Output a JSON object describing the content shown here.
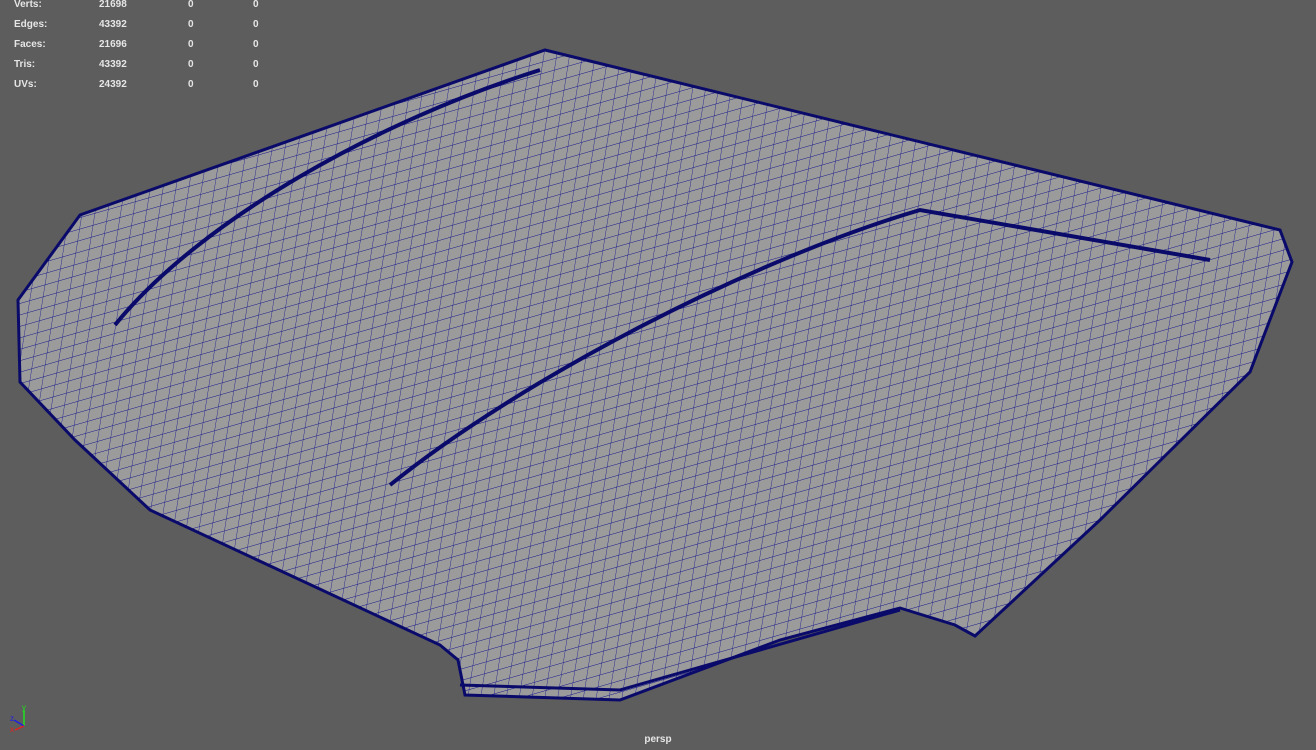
{
  "hud": {
    "rows": [
      {
        "label": "Verts:",
        "values": [
          "21698",
          "0",
          "0"
        ]
      },
      {
        "label": "Edges:",
        "values": [
          "43392",
          "0",
          "0"
        ]
      },
      {
        "label": "Faces:",
        "values": [
          "21696",
          "0",
          "0"
        ]
      },
      {
        "label": "Tris:",
        "values": [
          "43392",
          "0",
          "0"
        ]
      },
      {
        "label": "UVs:",
        "values": [
          "24392",
          "0",
          "0"
        ]
      }
    ]
  },
  "camera": {
    "name": "persp"
  },
  "axis": {
    "x": "x",
    "y": "y",
    "z": "z"
  },
  "colors": {
    "background": "#5d5d5d",
    "mesh_fill": "#9b9b9b",
    "wire": "#0a0a8c",
    "axis_x": "#e52020",
    "axis_y": "#20e020",
    "axis_z": "#2020e0"
  }
}
